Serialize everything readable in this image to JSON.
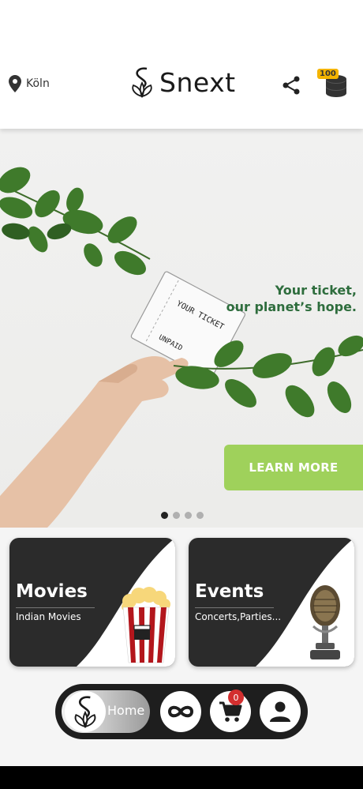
{
  "header": {
    "location": "Köln",
    "brand": "Snext",
    "coin_count": "100",
    "icons": {
      "location": "map-pin-icon",
      "share": "share-icon",
      "coins": "coin-stack-icon"
    }
  },
  "banner": {
    "tagline": "Your ticket,\nour planet’s hope.",
    "cta_label": "LEARN MORE",
    "slide_count": 4,
    "active_slide": 1,
    "colors": {
      "cta": "#9fd15b",
      "tagline": "#2e6d3d"
    }
  },
  "categories": [
    {
      "title": "Movies",
      "subtitle": "Indian Movies",
      "icon": "popcorn-icon"
    },
    {
      "title": "Events",
      "subtitle": "Concerts,Parties...",
      "icon": "microphone-icon"
    }
  ],
  "bottom_nav": {
    "home_label": "Home",
    "cart_count": "0",
    "icons": [
      "home-logo-icon",
      "infinity-icon",
      "cart-icon",
      "profile-icon"
    ]
  }
}
